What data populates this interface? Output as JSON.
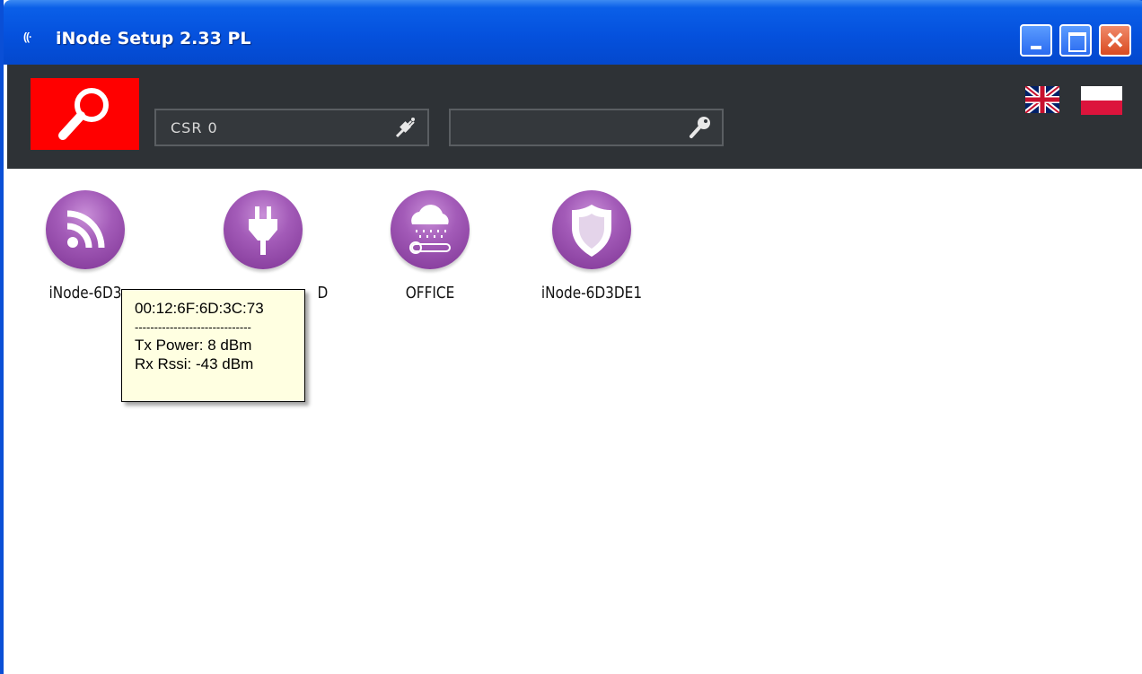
{
  "window": {
    "title_icon": "((·",
    "title": "iNode Setup 2.33 PL",
    "controls": {
      "minimize": "minimize-icon",
      "maximize": "maximize-icon",
      "close": "close-icon"
    }
  },
  "toolbar": {
    "search_icon": "magnifier-icon",
    "csr_field": {
      "value": "CSR 0",
      "icon": "plug-icon"
    },
    "key_field": {
      "value": "",
      "icon": "key-icon"
    },
    "languages": [
      "uk-flag-icon",
      "pl-flag-icon"
    ]
  },
  "devices": [
    {
      "label": "iNode-6D3",
      "icon": "rss-icon"
    },
    {
      "label": "D",
      "icon": "plug-icon"
    },
    {
      "label": "OFFICE",
      "icon": "weather-sensor-icon"
    },
    {
      "label": "iNode-6D3DE1",
      "icon": "shield-icon"
    }
  ],
  "tooltip": {
    "mac": "00:12:6F:6D:3C:73",
    "separator": "------------------------------",
    "tx_power": "Tx Power: 8 dBm",
    "rx_rssi": "Rx Rssi: -43 dBm"
  },
  "colors": {
    "accent_red": "#ff0000",
    "toolbar_bg": "#2e3236",
    "device_purple": "#a35bb8",
    "titlebar_blue": "#0551dd"
  }
}
